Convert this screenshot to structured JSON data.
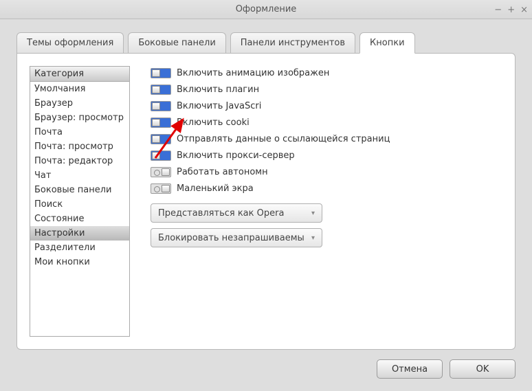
{
  "window": {
    "title": "Оформление",
    "min_icon": "−",
    "max_icon": "+",
    "close_icon": "×"
  },
  "tabs": [
    {
      "label": "Темы оформления",
      "active": false
    },
    {
      "label": "Боковые панели",
      "active": false
    },
    {
      "label": "Панели инструментов",
      "active": false
    },
    {
      "label": "Кнопки",
      "active": true
    }
  ],
  "sidebar": {
    "header": "Категория",
    "items": [
      "Умолчания",
      "Браузер",
      "Браузер: просмотр",
      "Почта",
      "Почта: просмотр",
      "Почта: редактор",
      "Чат",
      "Боковые панели",
      "Поиск",
      "Состояние",
      "Настройки",
      "Разделители",
      "Мои кнопки"
    ],
    "selected_index": 10
  },
  "options": [
    {
      "label": "Включить анимацию изображен",
      "on": true
    },
    {
      "label": "Включить плагин",
      "on": true
    },
    {
      "label": "Включить JavaScri",
      "on": true
    },
    {
      "label": "Включить cooki",
      "on": true
    },
    {
      "label": "Отправлять данные о ссылающейся страниц",
      "on": true
    },
    {
      "label": "Включить прокси-сервер",
      "on": true
    },
    {
      "label": "Работать автономн",
      "on": false
    },
    {
      "label": "Маленький экра",
      "on": false
    }
  ],
  "dropdowns": [
    {
      "label": "Представляться как Opera"
    },
    {
      "label": "Блокировать незапрашиваемы"
    }
  ],
  "footer": {
    "cancel": "Отмена",
    "ok": "OK"
  }
}
